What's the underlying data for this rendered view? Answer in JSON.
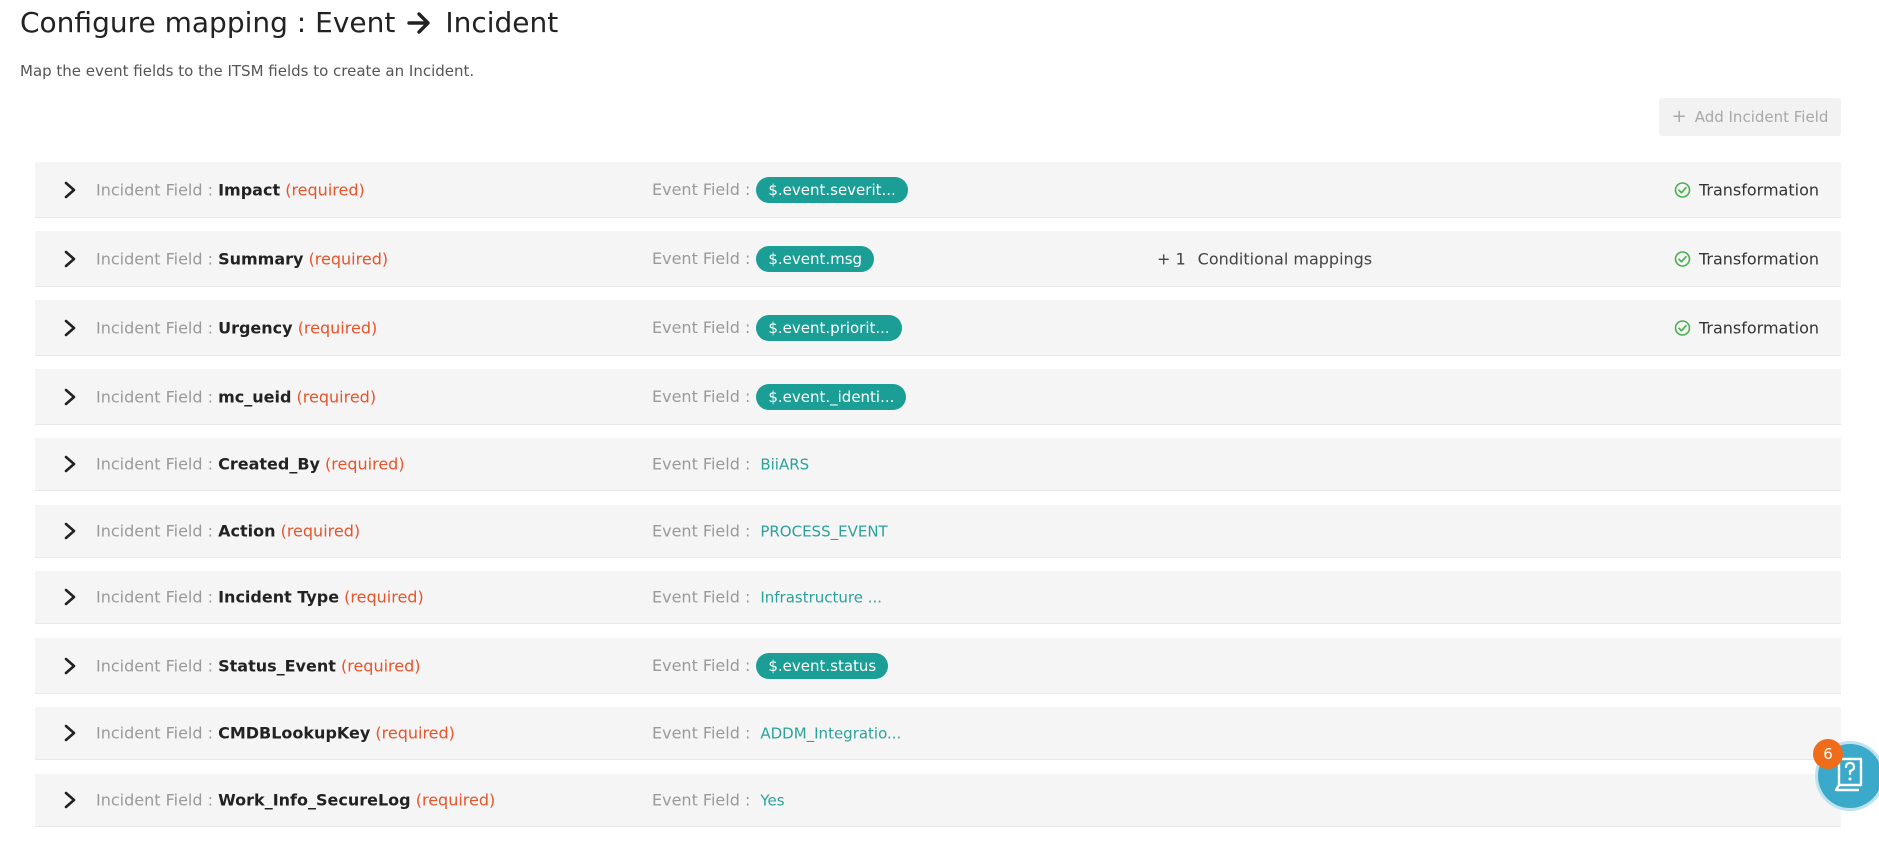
{
  "header": {
    "title_prefix": "Configure mapping : Event",
    "title_suffix": "Incident",
    "subtitle": "Map the event fields to the ITSM fields to create an Incident."
  },
  "toolbar": {
    "add_icon": "+",
    "add_label": "Add Incident Field"
  },
  "labels": {
    "incident_field": "Incident Field : ",
    "event_field": "Event Field : ",
    "required": "(required)",
    "transformation": "Transformation",
    "conditional_mappings": "Conditional mappings"
  },
  "rows": [
    {
      "field": "Impact",
      "event_value": "$.event.severit...",
      "event_style": "pill",
      "conditional_count": "",
      "transformation": true
    },
    {
      "field": "Summary",
      "event_value": "$.event.msg",
      "event_style": "pill",
      "conditional_count": "+ 1",
      "transformation": true
    },
    {
      "field": "Urgency",
      "event_value": "$.event.priorit...",
      "event_style": "pill",
      "conditional_count": "",
      "transformation": true
    },
    {
      "field": "mc_ueid",
      "event_value": "$.event._identi...",
      "event_style": "pill",
      "conditional_count": "",
      "transformation": false
    },
    {
      "field": "Created_By",
      "event_value": "BiiARS",
      "event_style": "plain",
      "conditional_count": "",
      "transformation": false
    },
    {
      "field": "Action",
      "event_value": "PROCESS_EVENT",
      "event_style": "plain",
      "conditional_count": "",
      "transformation": false
    },
    {
      "field": "Incident Type",
      "event_value": "Infrastructure ...",
      "event_style": "plain",
      "conditional_count": "",
      "transformation": false
    },
    {
      "field": "Status_Event",
      "event_value": "$.event.status",
      "event_style": "pill",
      "conditional_count": "",
      "transformation": false
    },
    {
      "field": "CMDBLookupKey",
      "event_value": "ADDM_Integratio...",
      "event_style": "plain",
      "conditional_count": "",
      "transformation": false
    },
    {
      "field": "Work_Info_SecureLog",
      "event_value": "Yes",
      "event_style": "plain",
      "conditional_count": "",
      "transformation": false
    }
  ],
  "help": {
    "badge_count": "6",
    "icon": "help-book-icon"
  },
  "colors": {
    "accent": "#1a9e96",
    "required": "#e8542c",
    "success": "#4caf50",
    "badge": "#ef6c1a"
  }
}
